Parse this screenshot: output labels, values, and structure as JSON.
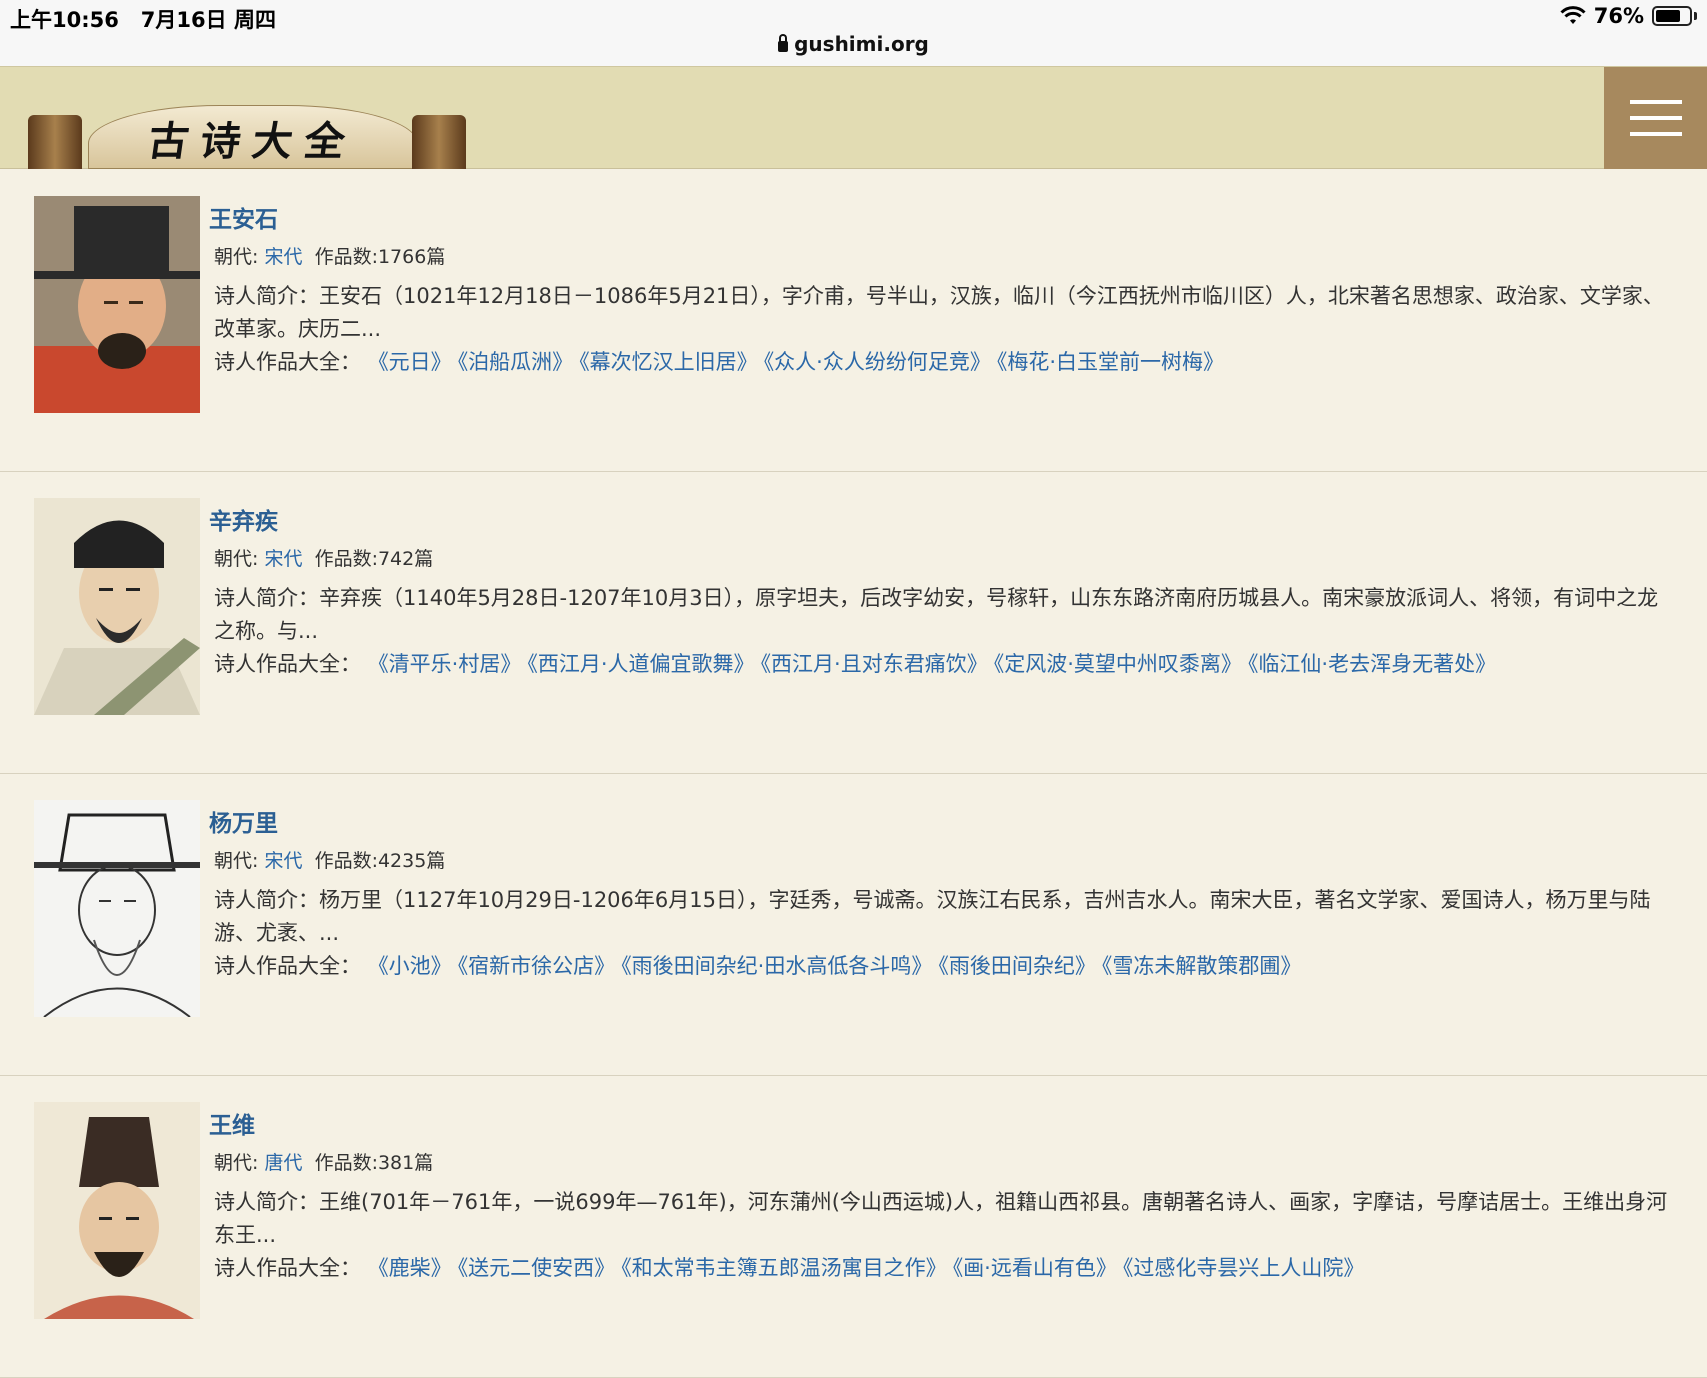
{
  "status": {
    "time": "上午10:56",
    "date": "7月16日 周四",
    "battery": "76%",
    "battery_level": 0.76,
    "url": "gushimi.org"
  },
  "header": {
    "logo_text": "古诗大全",
    "menu_icon": "hamburger-menu-icon"
  },
  "labels": {
    "dynasty": "朝代:",
    "count": "作品数:",
    "intro": "诗人简介：",
    "works": "诗人作品大全："
  },
  "poets": [
    {
      "name": "王安石",
      "dynasty": "宋代",
      "count": "1766篇",
      "intro": "王安石（1021年12月18日－1086年5月21日），字介甫，号半山，汉族，临川（今江西抚州市临川区）人，北宋著名思想家、政治家、文学家、改革家。庆历二...",
      "works": [
        "《元日》",
        "《泊船瓜洲》",
        "《幕次忆汉上旧居》",
        "《众人·众人纷纷何足竞》",
        "《梅花·白玉堂前一树梅》"
      ]
    },
    {
      "name": "辛弃疾",
      "dynasty": "宋代",
      "count": "742篇",
      "intro": "辛弃疾（1140年5月28日-1207年10月3日），原字坦夫，后改字幼安，号稼轩，山东东路济南府历城县人。南宋豪放派词人、将领，有词中之龙之称。与...",
      "works": [
        "《清平乐·村居》",
        "《西江月·人道偏宜歌舞》",
        "《西江月·且对东君痛饮》",
        "《定风波·莫望中州叹黍离》",
        "《临江仙·老去浑身无著处》"
      ]
    },
    {
      "name": "杨万里",
      "dynasty": "宋代",
      "count": "4235篇",
      "intro": "杨万里（1127年10月29日-1206年6月15日），字廷秀，号诚斋。汉族江右民系，吉州吉水人。南宋大臣，著名文学家、爱国诗人，杨万里与陆游、尤袤、...",
      "works": [
        "《小池》",
        "《宿新市徐公店》",
        "《雨後田间杂纪·田水高低各斗鸣》",
        "《雨後田间杂纪》",
        "《雪冻未解散策郡圃》"
      ]
    },
    {
      "name": "王维",
      "dynasty": "唐代",
      "count": "381篇",
      "intro": "王维(701年－761年，一说699年—761年)，河东蒲州(今山西运城)人，祖籍山西祁县。唐朝著名诗人、画家，字摩诘，号摩诘居士。王维出身河东王...",
      "works": [
        "《鹿柴》",
        "《送元二使安西》",
        "《和太常韦主簿五郎温汤寓目之作》",
        "《画·远看山有色》",
        "《过感化寺昙兴上人山院》"
      ]
    }
  ]
}
